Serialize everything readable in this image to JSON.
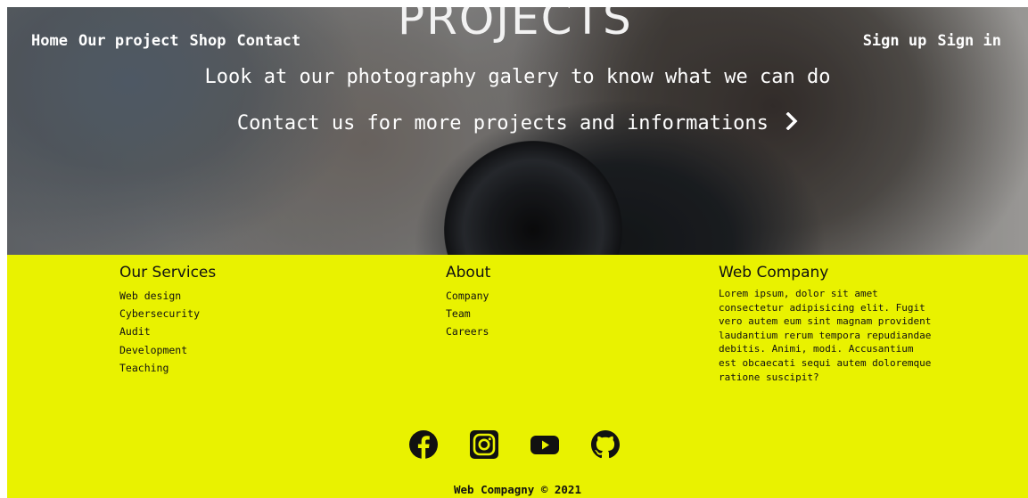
{
  "hero": {
    "title": "PROJECTS",
    "nav_left": [
      "Home",
      "Our project",
      "Shop",
      "Contact"
    ],
    "nav_right": [
      "Sign up",
      "Sign in"
    ],
    "subtitle": "Look at our photography galery to know what we can do",
    "cta": "Contact us for more projects and informations",
    "cta_icon": "chevron-right-icon"
  },
  "footer": {
    "background_color": "#e9f200",
    "services": {
      "title": "Our Services",
      "items": [
        "Web design",
        "Cybersecurity",
        "Audit",
        "Development",
        "Teaching"
      ]
    },
    "about": {
      "title": "About",
      "items": [
        "Company",
        "Team",
        "Careers"
      ]
    },
    "company": {
      "title": "Web Company",
      "text": "Lorem ipsum, dolor sit amet consectetur adipisicing elit. Fugit vero autem eum sint magnam provident laudantium rerum tempora repudiandae debitis. Animi, modi. Accusantium est obcaecati sequi autem doloremque ratione suscipit?"
    },
    "socials": [
      "facebook-icon",
      "instagram-icon",
      "youtube-icon",
      "github-icon"
    ],
    "copyright": "Web Compagny © 2021"
  }
}
